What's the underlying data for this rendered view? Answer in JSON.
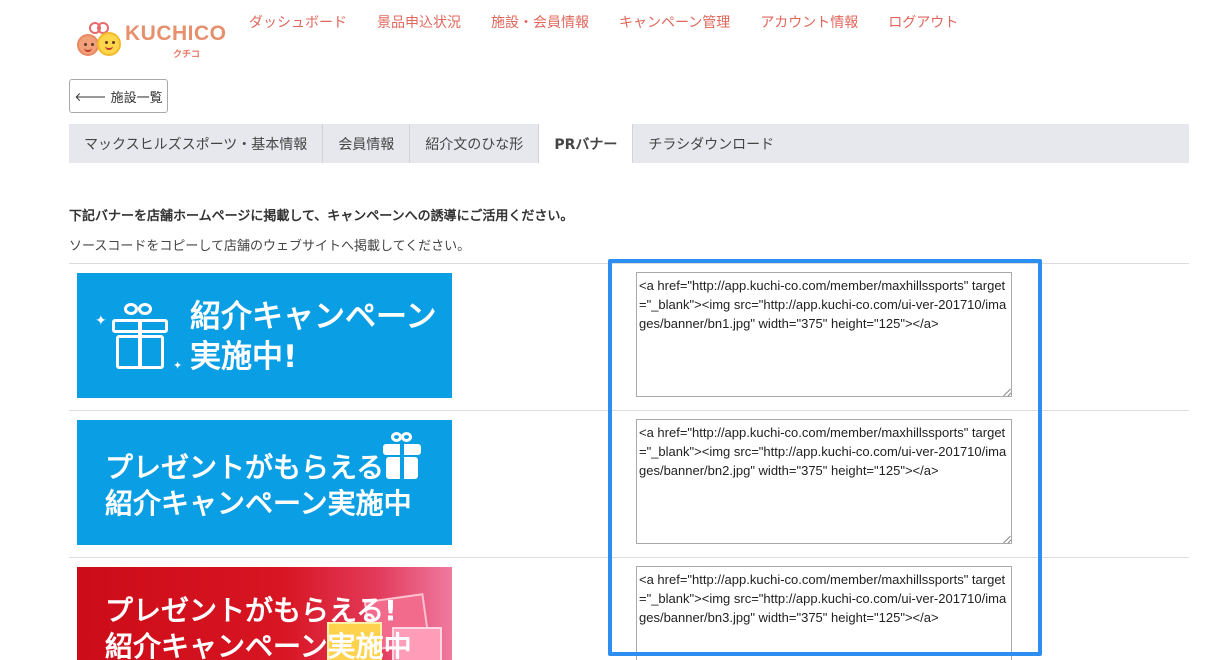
{
  "brand": {
    "name": "KUCHICO",
    "sub": "クチコ"
  },
  "nav": [
    "ダッシュボード",
    "景品申込状況",
    "施設・会員情報",
    "キャンペーン管理",
    "アカウント情報",
    "ログアウト"
  ],
  "back_button": {
    "icon": "arrow-left-icon",
    "label": "施設一覧"
  },
  "tabs": [
    {
      "label": "マックスヒルズスポーツ・基本情報",
      "active": false
    },
    {
      "label": "会員情報",
      "active": false
    },
    {
      "label": "紹介文のひな形",
      "active": false
    },
    {
      "label": "PRバナー",
      "active": true
    },
    {
      "label": "チラシダウンロード",
      "active": false
    }
  ],
  "intro": {
    "heading": "下記バナーを店舗ホームページに掲載して、キャンペーンへの誘導にご活用ください。",
    "note": "ソースコードをコピーして店舗のウェブサイトへ掲載してください。"
  },
  "banners": [
    {
      "line1": "紹介キャンペーン",
      "line2": "実施中!",
      "color": "#0a9ee4",
      "code": "<a href=\"http://app.kuchi-co.com/member/maxhillssports\" target=\"_blank\"><img src=\"http://app.kuchi-co.com/ui-ver-201710/images/banner/bn1.jpg\" width=\"375\" height=\"125\"></a>"
    },
    {
      "line1": "プレゼントがもらえる!",
      "line2": "紹介キャンペーン実施中",
      "color": "#0a9ee4",
      "code": "<a href=\"http://app.kuchi-co.com/member/maxhillssports\" target=\"_blank\"><img src=\"http://app.kuchi-co.com/ui-ver-201710/images/banner/bn2.jpg\" width=\"375\" height=\"125\"></a>"
    },
    {
      "line1": "プレゼントがもらえる!",
      "line2": "紹介キャンペーン実施中",
      "color": "#d8121e",
      "code": "<a href=\"http://app.kuchi-co.com/member/maxhillssports\" target=\"_blank\"><img src=\"http://app.kuchi-co.com/ui-ver-201710/images/banner/bn3.jpg\" width=\"375\" height=\"125\"></a>"
    }
  ],
  "highlight_color": "#2b8ef0"
}
